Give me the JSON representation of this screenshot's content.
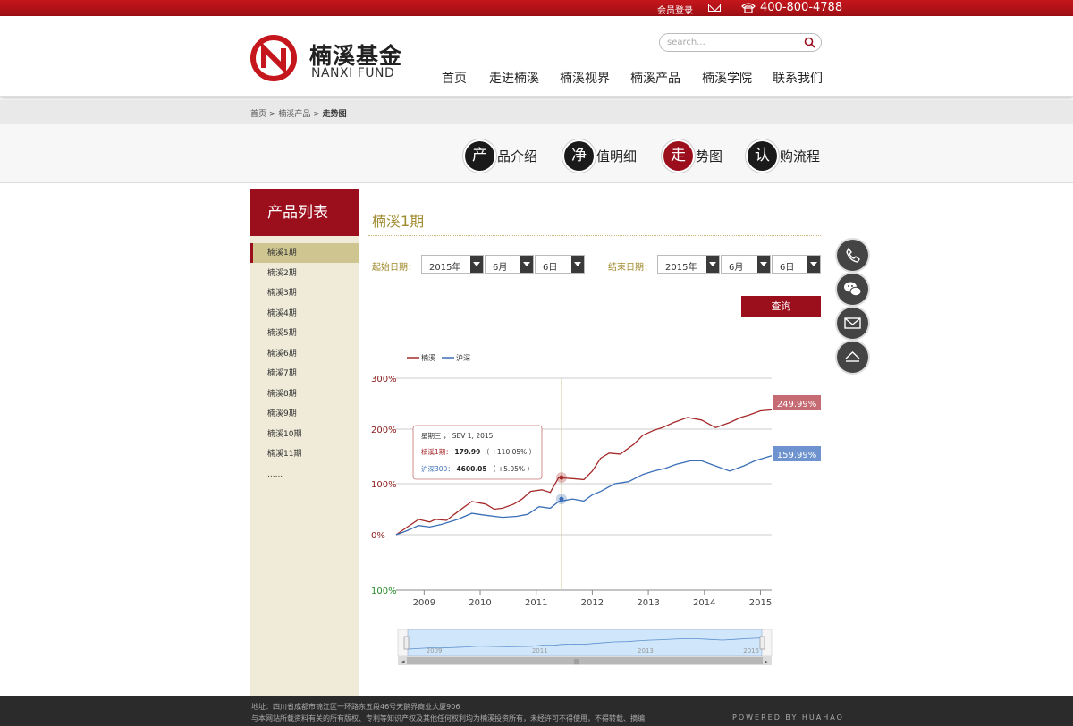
{
  "topbar": {
    "login": "会员登录",
    "phone": "400-800-4788"
  },
  "header": {
    "logo_cn": "楠溪基金",
    "logo_en": "NANXI FUND",
    "search_placeholder": "search...",
    "nav": [
      "首页",
      "走进楠溪",
      "楠溪视界",
      "楠溪产品",
      "楠溪学院",
      "联系我们"
    ]
  },
  "breadcrumb": {
    "home": "首页",
    "product": "楠溪产品",
    "current": "走势图",
    "sep": ">"
  },
  "subnav": [
    {
      "first": "产",
      "rest": "品介绍"
    },
    {
      "first": "净",
      "rest": "值明细"
    },
    {
      "first": "走",
      "rest": "势图"
    },
    {
      "first": "认",
      "rest": "购流程"
    }
  ],
  "sidebar": {
    "title": "产品列表",
    "items": [
      "楠溪1期",
      "楠溪2期",
      "楠溪3期",
      "楠溪4期",
      "楠溪5期",
      "楠溪6期",
      "楠溪7期",
      "楠溪8期",
      "楠溪9期",
      "楠溪10期",
      "楠溪11期",
      "......"
    ]
  },
  "main": {
    "title": "楠溪1期",
    "start_label": "起始日期：",
    "end_label": "结束日期：",
    "start": {
      "year": "2015年",
      "month": "6月",
      "day": "6日"
    },
    "end": {
      "year": "2015年",
      "month": "6月",
      "day": "6日"
    },
    "query": "查询"
  },
  "chart_data": {
    "type": "line",
    "legend": [
      "楠溪",
      "沪深"
    ],
    "colors": {
      "nanxi": "#a52a2a",
      "hushen": "#3a6fb7"
    },
    "y_ticks": [
      {
        "label": "300%",
        "value": 300
      },
      {
        "label": "200%",
        "value": 200
      },
      {
        "label": "100%",
        "value": 100
      },
      {
        "label": "0%",
        "value": 0
      },
      {
        "label": "100%",
        "value": -100
      }
    ],
    "x_ticks": [
      "2009",
      "2010",
      "2011",
      "2012",
      "2013",
      "2014",
      "2015"
    ],
    "series": [
      {
        "name": "楠溪",
        "x": [
          2008.6,
          2008.8,
          2009.0,
          2009.2,
          2009.3,
          2009.5,
          2009.7,
          2009.95,
          2010.2,
          2010.35,
          2010.5,
          2010.7,
          2010.85,
          2011.0,
          2011.2,
          2011.35,
          2011.5,
          2011.75,
          2011.95,
          2012.1,
          2012.25,
          2012.4,
          2012.6,
          2012.85,
          2013.0,
          2013.2,
          2013.35,
          2013.55,
          2013.8,
          2014.05,
          2014.3,
          2014.55,
          2014.75,
          2014.9,
          2015.1,
          2015.3
        ],
        "y": [
          0,
          15,
          30,
          25,
          30,
          28,
          45,
          65,
          60,
          50,
          52,
          60,
          70,
          85,
          88,
          83,
          112,
          110,
          108,
          125,
          150,
          160,
          158,
          178,
          195,
          205,
          210,
          220,
          230,
          225,
          210,
          220,
          230,
          235,
          243,
          245
        ]
      },
      {
        "name": "沪深",
        "x": [
          2008.6,
          2008.8,
          2009.0,
          2009.2,
          2009.4,
          2009.7,
          2009.95,
          2010.2,
          2010.5,
          2010.75,
          2010.95,
          2011.15,
          2011.35,
          2011.5,
          2011.75,
          2011.95,
          2012.1,
          2012.25,
          2012.5,
          2012.75,
          2013.0,
          2013.2,
          2013.4,
          2013.6,
          2013.85,
          2014.05,
          2014.3,
          2014.55,
          2014.8,
          2015.0,
          2015.3
        ],
        "y": [
          0,
          8,
          18,
          15,
          20,
          30,
          42,
          38,
          34,
          36,
          40,
          55,
          52,
          65,
          70,
          66,
          78,
          85,
          100,
          104,
          118,
          125,
          130,
          138,
          145,
          145,
          135,
          125,
          135,
          145,
          155
        ]
      }
    ],
    "end_labels": {
      "nanxi": "249.99%",
      "hushen": "159.99%"
    },
    "tooltip": {
      "date": "星期三 ， SEV 1, 2015",
      "line1_label": "楠溪1期：",
      "line1_value": "179.99",
      "line1_change": "（ +110.05% ）",
      "line2_label": "沪深300：",
      "line2_value": "4600.05",
      "line2_change": "（ +5.05% ）"
    },
    "navigator_ticks": [
      "2009",
      "2011",
      "2013",
      "2015"
    ]
  },
  "footer": {
    "address": "地址：四川省成都市锦江区一环路东五段46号天鹅界商业大厦906",
    "copyright": "与本网站所载资料有关的所有版权、专利等知识产权及其他任何权利均为楠溪投资所有，未经许可不得使用，不得转载、摘编",
    "powered": "POWERED BY HUAHAO"
  }
}
